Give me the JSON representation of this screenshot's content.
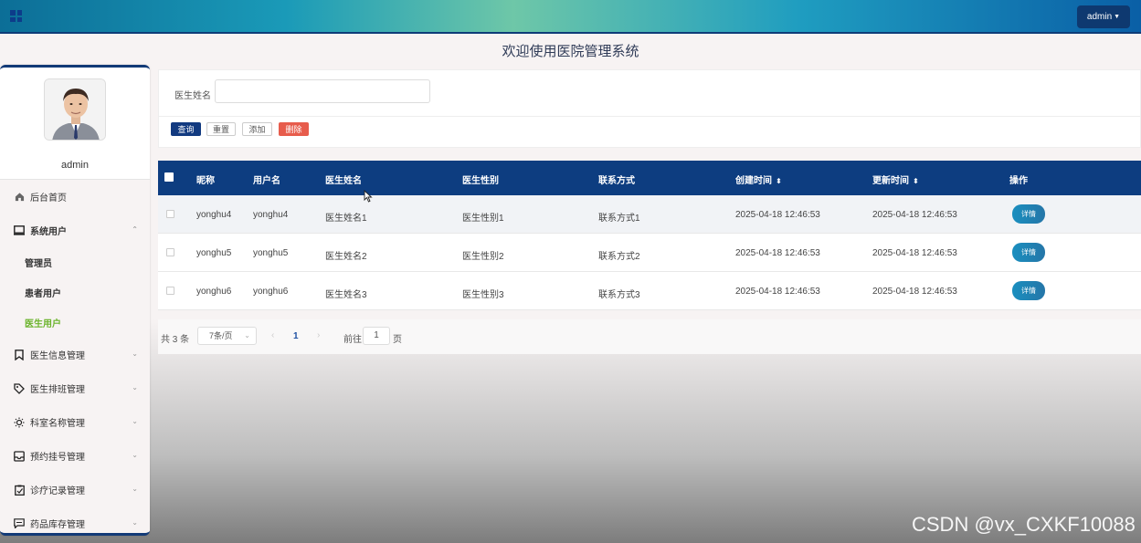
{
  "header": {
    "user_label": "admin"
  },
  "page_title": "欢迎使用医院管理系统",
  "sidebar": {
    "profile_name": "admin",
    "items": [
      {
        "label": "后台首页",
        "icon": "home-icon"
      },
      {
        "label": "系统用户",
        "icon": "monitor-icon",
        "expanded": true,
        "children": [
          {
            "label": "管理员"
          },
          {
            "label": "患者用户"
          },
          {
            "label": "医生用户",
            "active": true
          }
        ]
      },
      {
        "label": "医生信息管理",
        "icon": "bookmark-icon"
      },
      {
        "label": "医生排班管理",
        "icon": "tag-icon"
      },
      {
        "label": "科室名称管理",
        "icon": "sun-icon"
      },
      {
        "label": "预约挂号管理",
        "icon": "inbox-icon"
      },
      {
        "label": "诊疗记录管理",
        "icon": "clipboard-icon"
      },
      {
        "label": "药品库存管理",
        "icon": "message-icon"
      }
    ]
  },
  "search": {
    "label": "医生姓名",
    "value": "",
    "buttons": {
      "query": "查询",
      "reset": "重置",
      "add": "添加",
      "delete": "删除"
    }
  },
  "table": {
    "columns": [
      "昵称",
      "用户名",
      "医生姓名",
      "医生性别",
      "联系方式",
      "创建时间",
      "更新时间",
      "操作"
    ],
    "rows": [
      {
        "nickname": "yonghu4",
        "username": "yonghu4",
        "doctor_name": "医生姓名1",
        "gender": "医生性别1",
        "contact": "联系方式1",
        "created": "2025-04-18 12:46:53",
        "updated": "2025-04-18 12:46:53",
        "action": "详情"
      },
      {
        "nickname": "yonghu5",
        "username": "yonghu5",
        "doctor_name": "医生姓名2",
        "gender": "医生性别2",
        "contact": "联系方式2",
        "created": "2025-04-18 12:46:53",
        "updated": "2025-04-18 12:46:53",
        "action": "详情"
      },
      {
        "nickname": "yonghu6",
        "username": "yonghu6",
        "doctor_name": "医生姓名3",
        "gender": "医生性别3",
        "contact": "联系方式3",
        "created": "2025-04-18 12:46:53",
        "updated": "2025-04-18 12:46:53",
        "action": "详情"
      }
    ]
  },
  "pagination": {
    "total_text": "共 3 条",
    "page_size": "7条/页",
    "current_page": "1",
    "goto_label": "前往",
    "goto_value": "1",
    "goto_unit": "页"
  },
  "watermark": "CSDN @vx_CXKF10088",
  "colors": {
    "header_dark": "#0d3d80",
    "delete": "#e75c4c",
    "active_menu": "#6ab32a"
  }
}
